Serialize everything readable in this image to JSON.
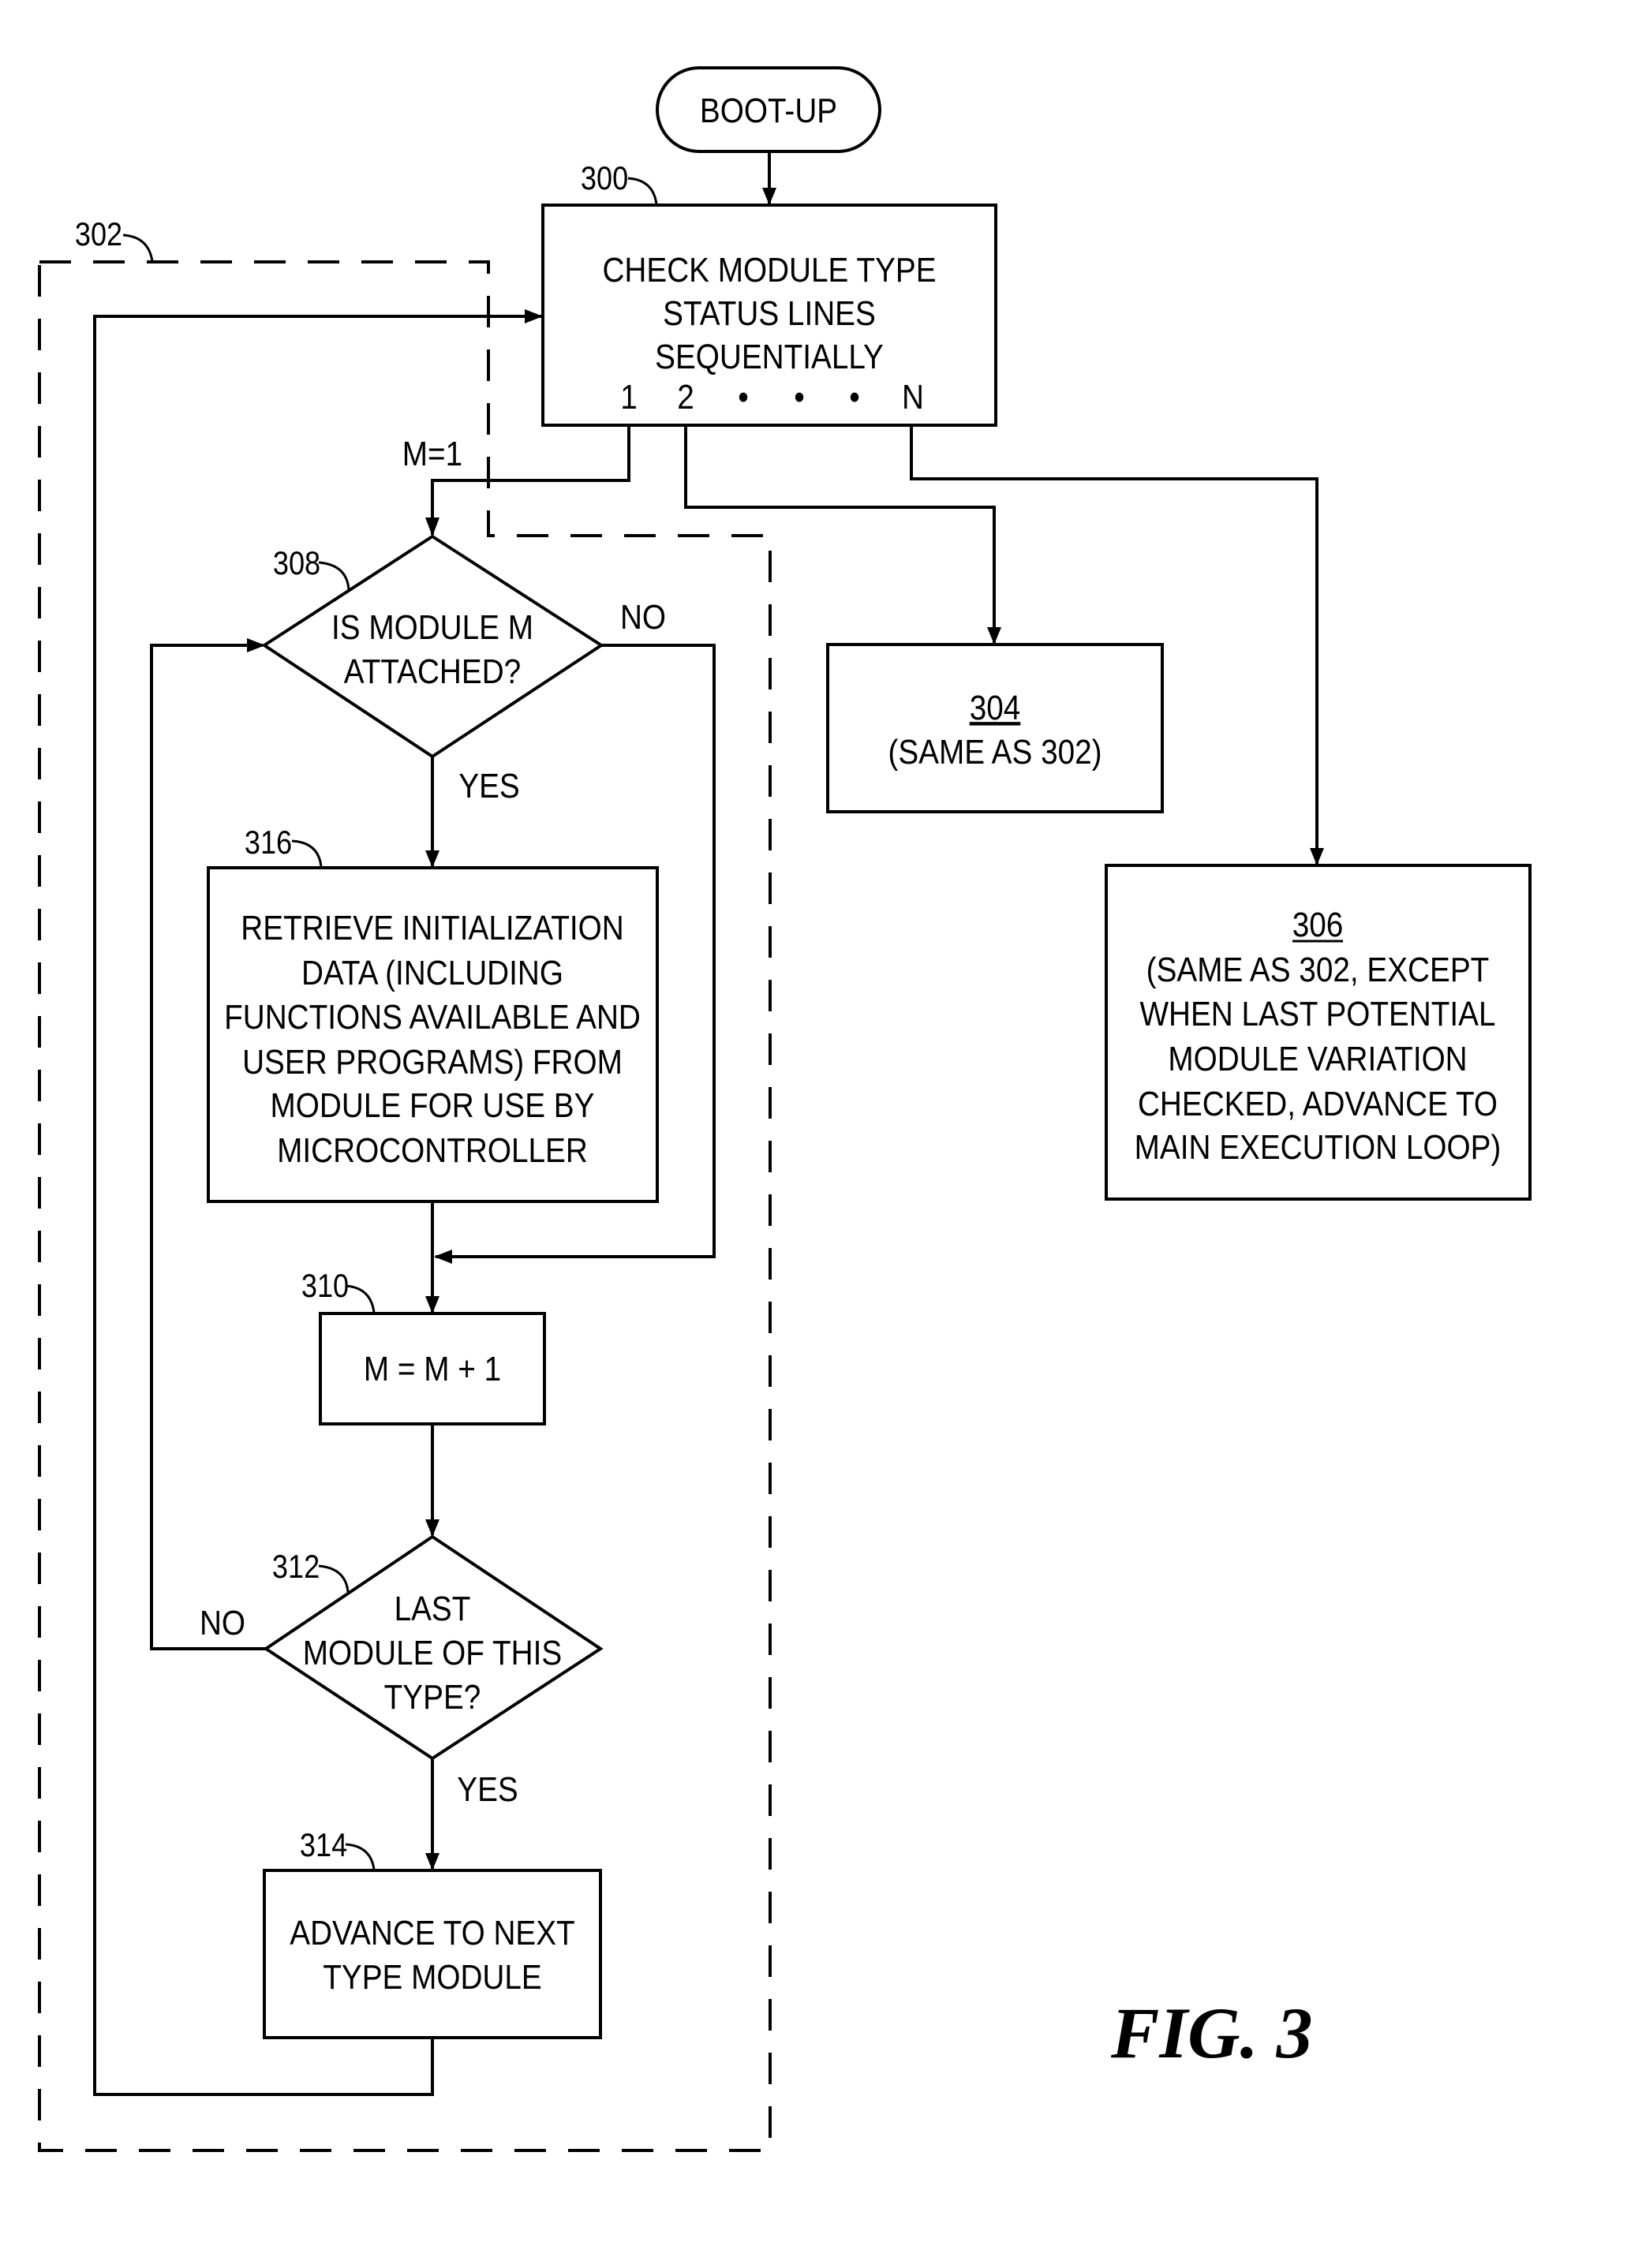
{
  "figure": {
    "caption": "FIG. 3",
    "start": {
      "label": "BOOT-UP"
    },
    "nodes": {
      "n300": {
        "ref": "300",
        "type": "process",
        "lines": [
          "CHECK MODULE TYPE",
          "STATUS LINES",
          "SEQUENTIALLY"
        ],
        "outputs": [
          "1",
          "2",
          "•",
          "•",
          "•",
          "N"
        ]
      },
      "n302": {
        "ref": "302",
        "type": "dashed-group"
      },
      "n304": {
        "ref": "304",
        "type": "process",
        "lines": [
          "(SAME AS 302)"
        ]
      },
      "n306": {
        "ref": "306",
        "type": "process",
        "lines": [
          "(SAME AS 302, EXCEPT",
          "WHEN LAST POTENTIAL",
          "MODULE VARIATION",
          "CHECKED, ADVANCE TO",
          "MAIN EXECUTION LOOP)"
        ]
      },
      "n308": {
        "ref": "308",
        "type": "decision",
        "lines": [
          "IS MODULE M",
          "ATTACHED?"
        ]
      },
      "n316": {
        "ref": "316",
        "type": "process",
        "lines": [
          "RETRIEVE INITIALIZATION",
          "DATA (INCLUDING",
          "FUNCTIONS AVAILABLE AND",
          "USER PROGRAMS) FROM",
          "MODULE FOR USE BY",
          "MICROCONTROLLER"
        ]
      },
      "n310": {
        "ref": "310",
        "type": "process",
        "lines": [
          "M = M + 1"
        ]
      },
      "n312": {
        "ref": "312",
        "type": "decision",
        "lines": [
          "LAST",
          "MODULE OF THIS",
          "TYPE?"
        ]
      },
      "n314": {
        "ref": "314",
        "type": "process",
        "lines": [
          "ADVANCE TO NEXT",
          "TYPE MODULE"
        ]
      }
    },
    "edge_labels": {
      "m_init": "M=1",
      "n308_no": "NO",
      "n308_yes": "YES",
      "n312_no": "NO",
      "n312_yes": "YES"
    },
    "edges": [
      {
        "from": "start",
        "to": "n300"
      },
      {
        "from": "n300",
        "to": "n308",
        "via": "output 1",
        "label": "M=1"
      },
      {
        "from": "n300",
        "to": "n304",
        "via": "output 2"
      },
      {
        "from": "n300",
        "to": "n306",
        "via": "output N"
      },
      {
        "from": "n308",
        "to": "n316",
        "label": "YES"
      },
      {
        "from": "n308",
        "to": "n310",
        "label": "NO"
      },
      {
        "from": "n316",
        "to": "n310"
      },
      {
        "from": "n310",
        "to": "n312"
      },
      {
        "from": "n312",
        "to": "n308",
        "label": "NO"
      },
      {
        "from": "n312",
        "to": "n314",
        "label": "YES"
      },
      {
        "from": "n314",
        "to": "n300"
      }
    ]
  }
}
